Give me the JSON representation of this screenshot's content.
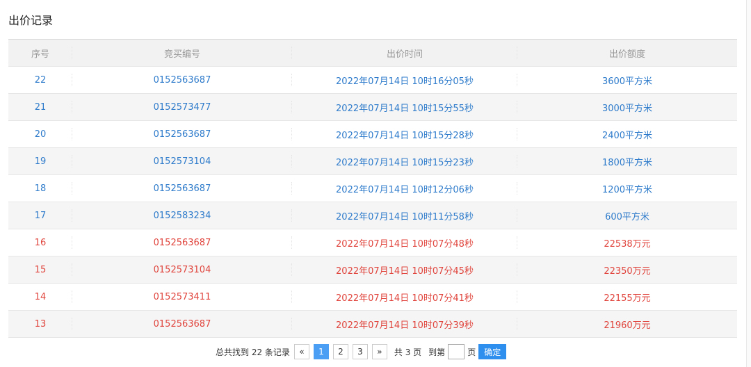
{
  "page": {
    "title": "出价记录"
  },
  "table": {
    "headers": [
      "序号",
      "竞买编号",
      "出价时间",
      "出价额度"
    ],
    "rows": [
      {
        "no": "22",
        "id": "0152563687",
        "time": "2022年07月14日 10时16分05秒",
        "amount": "3600平方米",
        "status": "blue"
      },
      {
        "no": "21",
        "id": "0152573477",
        "time": "2022年07月14日 10时15分55秒",
        "amount": "3000平方米",
        "status": "blue"
      },
      {
        "no": "20",
        "id": "0152563687",
        "time": "2022年07月14日 10时15分28秒",
        "amount": "2400平方米",
        "status": "blue"
      },
      {
        "no": "19",
        "id": "0152573104",
        "time": "2022年07月14日 10时15分23秒",
        "amount": "1800平方米",
        "status": "blue"
      },
      {
        "no": "18",
        "id": "0152563687",
        "time": "2022年07月14日 10时12分06秒",
        "amount": "1200平方米",
        "status": "blue"
      },
      {
        "no": "17",
        "id": "0152583234",
        "time": "2022年07月14日 10时11分58秒",
        "amount": "600平方米",
        "status": "blue"
      },
      {
        "no": "16",
        "id": "0152563687",
        "time": "2022年07月14日 10时07分48秒",
        "amount": "22538万元",
        "status": "red"
      },
      {
        "no": "15",
        "id": "0152573104",
        "time": "2022年07月14日 10时07分45秒",
        "amount": "22350万元",
        "status": "red"
      },
      {
        "no": "14",
        "id": "0152573411",
        "time": "2022年07月14日 10时07分41秒",
        "amount": "22155万元",
        "status": "red"
      },
      {
        "no": "13",
        "id": "0152563687",
        "time": "2022年07月14日 10时07分39秒",
        "amount": "21960万元",
        "status": "red"
      }
    ]
  },
  "pager": {
    "total_text": "总共找到 22 条记录",
    "prev": "«",
    "pages": [
      "1",
      "2",
      "3"
    ],
    "current": "1",
    "next": "»",
    "page_count_text": "共 3 页",
    "goto_label": "到第",
    "page_suffix": "页",
    "confirm": "确定"
  },
  "colors": {
    "blue": "#2e7bcb",
    "red": "#e0443c",
    "active": "#4a9ff5"
  }
}
